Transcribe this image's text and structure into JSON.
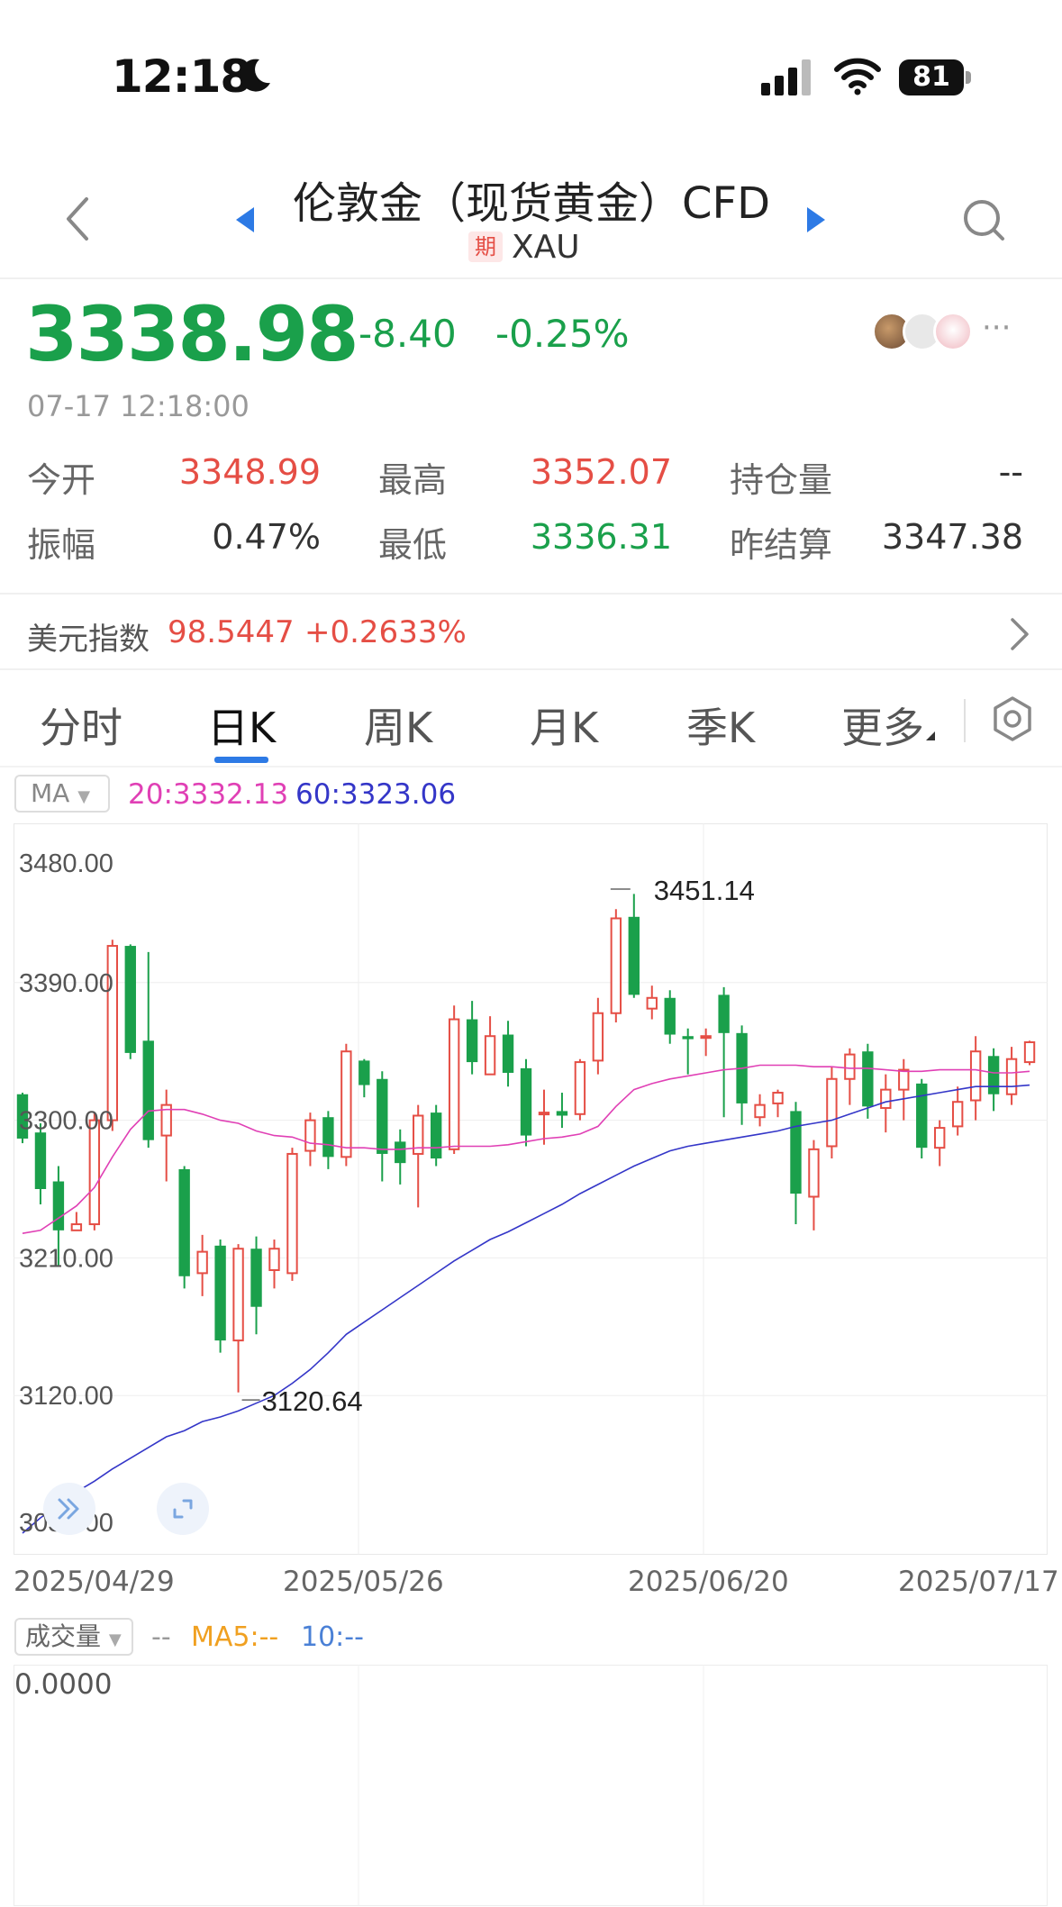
{
  "status_bar": {
    "time": "12:18",
    "battery": "81"
  },
  "header": {
    "title": "伦敦金（现货黄金）CFD",
    "badge": "期",
    "code": "XAU"
  },
  "quote": {
    "price": "3338.98",
    "change": "-8.40",
    "change_pct": "-0.25%",
    "timestamp": "07-17 12:18:00",
    "more": "···"
  },
  "stats": {
    "open_label": "今开",
    "open_value": "3348.99",
    "high_label": "最高",
    "high_value": "3352.07",
    "oi_label": "持仓量",
    "oi_value": "--",
    "amp_label": "振幅",
    "amp_value": "0.47%",
    "low_label": "最低",
    "low_value": "3336.31",
    "prev_label": "昨结算",
    "prev_value": "3347.38"
  },
  "usd_index": {
    "label": "美元指数",
    "value": "98.5447",
    "change": "+0.2633%"
  },
  "tabs": [
    "分时",
    "日K",
    "周K",
    "月K",
    "季K",
    "更多"
  ],
  "active_tab": 1,
  "indicator": {
    "name": "MA",
    "ma20": "20:3332.13",
    "ma60": "60:3323.06"
  },
  "colors": {
    "up": "#e54e45",
    "down": "#1aa04b",
    "ma20": "#e040b5",
    "ma60": "#3436c8",
    "accent": "#2d7ae5"
  },
  "chart_data": {
    "type": "candlestick",
    "ylim": [
      3030,
      3480
    ],
    "yticks": [
      "3480.00",
      "3390.00",
      "3300.00",
      "3210.00",
      "3120.00",
      "3030.00"
    ],
    "xticks": [
      "2025/04/29",
      "2025/05/26",
      "2025/06/20",
      "2025/07/17"
    ],
    "high_label": "3451.14",
    "low_label": "3120.64",
    "candles": [
      [
        3317,
        3288,
        3318,
        3285
      ],
      [
        3292,
        3255,
        3298,
        3245
      ],
      [
        3260,
        3228,
        3270,
        3205
      ],
      [
        3228,
        3232,
        3240,
        3228
      ],
      [
        3232,
        3300,
        3305,
        3228
      ],
      [
        3300,
        3414,
        3418,
        3293
      ],
      [
        3414,
        3344,
        3415,
        3340
      ],
      [
        3352,
        3287,
        3410,
        3282
      ],
      [
        3290,
        3310,
        3320,
        3260
      ],
      [
        3268,
        3198,
        3270,
        3190
      ],
      [
        3200,
        3214,
        3225,
        3185
      ],
      [
        3218,
        3156,
        3222,
        3148
      ],
      [
        3156,
        3216,
        3219,
        3122
      ],
      [
        3216,
        3178,
        3224,
        3160
      ],
      [
        3202,
        3216,
        3222,
        3190
      ],
      [
        3200,
        3278,
        3282,
        3195
      ],
      [
        3280,
        3300,
        3305,
        3270
      ],
      [
        3302,
        3276,
        3306,
        3268
      ],
      [
        3276,
        3345,
        3350,
        3270
      ],
      [
        3339,
        3323,
        3340,
        3315
      ],
      [
        3327,
        3278,
        3332,
        3260
      ],
      [
        3286,
        3272,
        3294,
        3258
      ],
      [
        3278,
        3303,
        3310,
        3243
      ],
      [
        3305,
        3275,
        3310,
        3270
      ],
      [
        3281,
        3366,
        3375,
        3278
      ],
      [
        3366,
        3338,
        3378,
        3330
      ],
      [
        3330,
        3355,
        3368,
        3330
      ],
      [
        3356,
        3331,
        3365,
        3322
      ],
      [
        3334,
        3290,
        3340,
        3283
      ],
      [
        3304,
        3305,
        3320,
        3284
      ],
      [
        3306,
        3303,
        3318,
        3295
      ],
      [
        3304,
        3338,
        3340,
        3300
      ],
      [
        3339,
        3370,
        3380,
        3330
      ],
      [
        3370,
        3432,
        3438,
        3364
      ],
      [
        3433,
        3382,
        3448,
        3380
      ],
      [
        3373,
        3380,
        3388,
        3366
      ],
      [
        3380,
        3356,
        3385,
        3350
      ],
      [
        3355,
        3353,
        3360,
        3330
      ],
      [
        3354,
        3355,
        3360,
        3342
      ],
      [
        3382,
        3357,
        3387,
        3302
      ],
      [
        3357,
        3311,
        3362,
        3297
      ],
      [
        3302,
        3310,
        3317,
        3296
      ],
      [
        3311,
        3318,
        3320,
        3302
      ],
      [
        3306,
        3252,
        3312,
        3232
      ],
      [
        3250,
        3281,
        3287,
        3228
      ],
      [
        3283,
        3327,
        3335,
        3275
      ],
      [
        3327,
        3343,
        3347,
        3310
      ],
      [
        3345,
        3309,
        3350,
        3301
      ],
      [
        3308,
        3320,
        3330,
        3292
      ],
      [
        3320,
        3333,
        3340,
        3300
      ],
      [
        3324,
        3282,
        3327,
        3275
      ],
      [
        3282,
        3295,
        3300,
        3270
      ],
      [
        3296,
        3312,
        3322,
        3290
      ],
      [
        3313,
        3345,
        3355,
        3300
      ],
      [
        3342,
        3317,
        3347,
        3306
      ],
      [
        3317,
        3340,
        3348,
        3310
      ],
      [
        3338,
        3351,
        3352,
        3336
      ]
    ],
    "ma20": [
      3226,
      3228,
      3236,
      3244,
      3256,
      3276,
      3294,
      3306,
      3307,
      3307,
      3304,
      3300,
      3298,
      3293,
      3290,
      3289,
      3285,
      3284,
      3282,
      3282,
      3281,
      3281,
      3282,
      3282,
      3283,
      3283,
      3283,
      3284,
      3286,
      3288,
      3289,
      3291,
      3296,
      3309,
      3320,
      3324,
      3327,
      3329,
      3331,
      3333,
      3334,
      3336,
      3336,
      3336,
      3335,
      3335,
      3334,
      3334,
      3333,
      3332,
      3332,
      3333,
      3333,
      3333,
      3331,
      3331,
      3332
    ],
    "ma60": [
      3030,
      3040,
      3048,
      3057,
      3064,
      3072,
      3079,
      3086,
      3093,
      3097,
      3103,
      3106,
      3110,
      3115,
      3120,
      3128,
      3137,
      3148,
      3160,
      3168,
      3176,
      3184,
      3192,
      3200,
      3208,
      3215,
      3222,
      3227,
      3233,
      3239,
      3245,
      3252,
      3258,
      3264,
      3270,
      3275,
      3280,
      3283,
      3285,
      3287,
      3289,
      3291,
      3293,
      3296,
      3298,
      3300,
      3304,
      3308,
      3312,
      3314,
      3316,
      3318,
      3320,
      3322,
      3322,
      3322,
      3323
    ]
  },
  "volume": {
    "label": "成交量",
    "dash": "--",
    "ma5": "MA5:--",
    "ma10": "10:--",
    "value": "0.0000"
  }
}
